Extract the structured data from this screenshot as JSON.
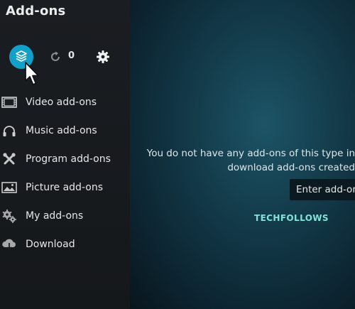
{
  "header": {
    "title": "Add-ons"
  },
  "toolbar": {
    "addon_browser_icon": "open-box-icon",
    "update_icon": "refresh-icon",
    "update_count": "0",
    "settings_icon": "gear-icon"
  },
  "sidebar": {
    "items": [
      {
        "label": "Video add-ons",
        "icon": "film-icon"
      },
      {
        "label": "Music add-ons",
        "icon": "headphones-icon"
      },
      {
        "label": "Program add-ons",
        "icon": "tools-icon"
      },
      {
        "label": "Picture add-ons",
        "icon": "picture-icon"
      },
      {
        "label": "My add-ons",
        "icon": "gears-icon"
      },
      {
        "label": "Download",
        "icon": "cloud-download-icon"
      }
    ]
  },
  "main": {
    "message_line1": "You do not have any add-ons of this type in",
    "message_line2": "download add-ons created",
    "search_button_label": "Enter add-on b",
    "watermark": "TECHFOLLOWS"
  },
  "colors": {
    "accent": "#12a0c8",
    "sidebar_bg": "#1a1d21",
    "main_bg": "#143d4c",
    "watermark": "#7ee6d8"
  }
}
